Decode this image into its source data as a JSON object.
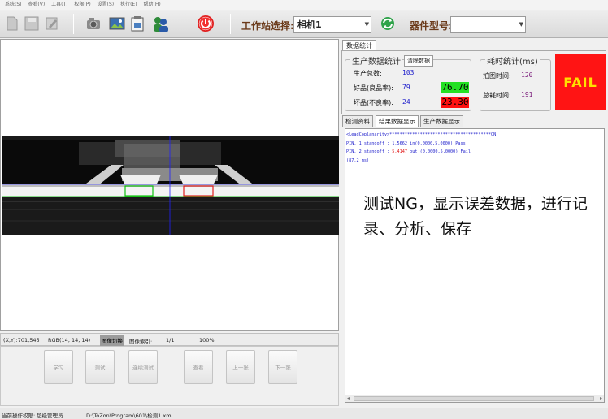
{
  "menu": [
    "系统(S)",
    "查看(V)",
    "工具(T)",
    "权限(P)",
    "设置(S)",
    "执行(E)",
    "帮助(H)"
  ],
  "toolbar": {
    "icons": [
      "new-icon",
      "save-icon",
      "edit-icon",
      "camera-icon",
      "image-icon",
      "clipboard-icon",
      "users-icon",
      "power-icon",
      "refresh-icon"
    ],
    "station_label": "工作站选择:",
    "station_value": "相机1",
    "device_label": "器件型号:",
    "device_value": ""
  },
  "image_status": {
    "coords": "(X,Y):701,545",
    "rgb": "RGB(14, 14, 14)",
    "image_toggle": "图像切换",
    "image_index_label": "图像索引:",
    "image_index": "1/1",
    "zoom": "100%"
  },
  "actions": [
    "学习",
    "测试",
    "连续测试",
    "查看",
    "上一张",
    "下一张"
  ],
  "stats": {
    "tab": "数据统计",
    "production_title": "生产数据统计",
    "clear_button": "清除数据",
    "total_label": "生产总数:",
    "total": "103",
    "good_label": "好品(良品率):",
    "good": "79",
    "good_rate": "76.70",
    "bad_label": "坏品(不良率):",
    "bad": "24",
    "bad_rate": "23.30",
    "time_title": "耗时统计(ms)",
    "capture_label": "拍图时间:",
    "capture_time": "120",
    "total_time_label": "总耗时间:",
    "total_time": "191",
    "result": "FAIL",
    "colors": {
      "good_bg": "#22e022",
      "bad_bg": "#ff1010",
      "fail_bg": "#ff1414",
      "fail_text": "#ffe000"
    }
  },
  "result_tabs": [
    "检测资料",
    "结果数据显示",
    "生产数据显示"
  ],
  "result_lines": [
    "<LeadCoplanarity>****************************************ON",
    "PIN. 1 standoff :   1.5662 in(0.0000,5.0000) Pass",
    "PIN. 2 standoff :   5.4147 out (0.0000,5.0000) Fail",
    "(87.2 ms)"
  ],
  "note": "测试NG，显示误差数据，进行记录、分析、保存",
  "statusbar": {
    "user_label": "当前操作权限:",
    "user": "超级管理员",
    "path": "D:\\ToZon\\Program\\601\\检测1.xml"
  }
}
